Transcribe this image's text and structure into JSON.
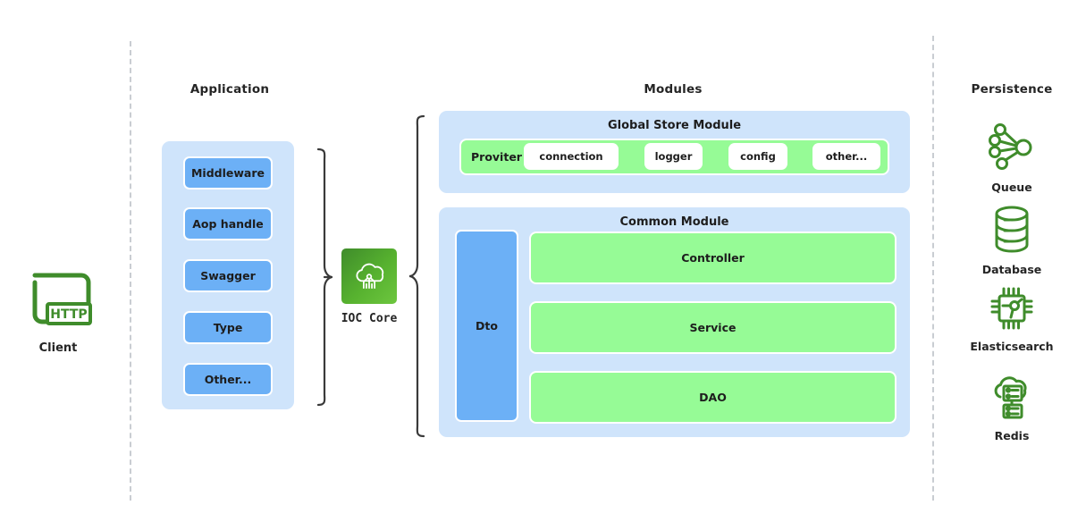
{
  "columns": {
    "application_title": "Application",
    "modules_title": "Modules",
    "persistence_title": "Persistence"
  },
  "client": {
    "icon": "client-http-icon",
    "badge": "HTTP",
    "label": "Client"
  },
  "application": {
    "items": [
      {
        "label": "Middleware"
      },
      {
        "label": "Aop handle"
      },
      {
        "label": "Swagger"
      },
      {
        "label": "Type"
      },
      {
        "label": "Other..."
      }
    ]
  },
  "ioc": {
    "icon": "cloud-network-icon",
    "label": "IOC Core"
  },
  "global_store": {
    "title": "Global Store Module",
    "provider_label": "Proviter",
    "chips": [
      {
        "label": "connection"
      },
      {
        "label": "logger"
      },
      {
        "label": "config"
      },
      {
        "label": "other..."
      }
    ]
  },
  "common_module": {
    "title": "Common Module",
    "dto_label": "Dto",
    "layers": [
      {
        "label": "Controller"
      },
      {
        "label": "Service"
      },
      {
        "label": "DAO"
      }
    ]
  },
  "persistence": {
    "items": [
      {
        "icon": "queue-icon",
        "label": "Queue"
      },
      {
        "icon": "database-icon",
        "label": "Database"
      },
      {
        "icon": "chip-search-icon",
        "label": "Elasticsearch"
      },
      {
        "icon": "cloud-server-icon",
        "label": "Redis"
      }
    ]
  },
  "colors": {
    "panel_blue": "#cfe4fb",
    "chip_blue": "#6cb0f6",
    "green": "#96fb96",
    "icon_green": "#3f8c2b",
    "divider": "#c9cdd2"
  }
}
